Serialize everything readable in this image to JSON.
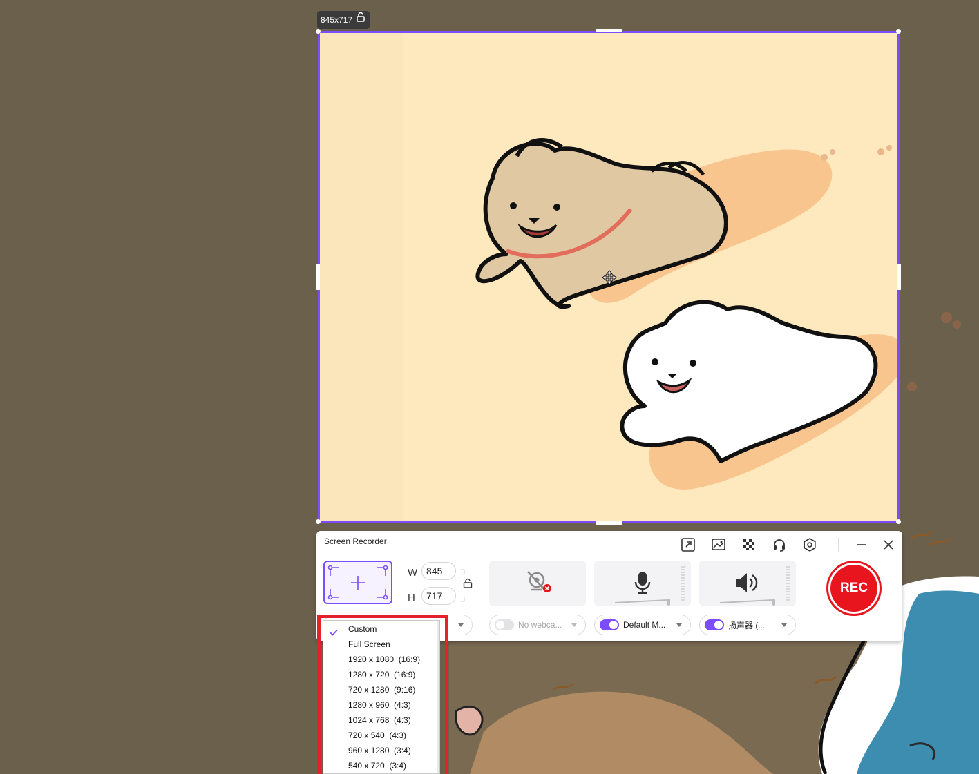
{
  "capture": {
    "size_label": "845x717"
  },
  "recorder": {
    "title": "Screen Recorder",
    "toolbar": {
      "icons": [
        "external-window-icon",
        "screenshot-edit-icon",
        "checkerboard-icon",
        "headset-icon",
        "settings-icon"
      ],
      "minimize_icon": "minimize-icon",
      "close_icon": "close-icon"
    },
    "width_label": "W",
    "height_label": "H",
    "width_value": "845",
    "height_value": "717",
    "webcam": {
      "label": "No webca...",
      "enabled": false
    },
    "microphone": {
      "label": "Default M...",
      "enabled": true
    },
    "speaker": {
      "label": "扬声器 (...",
      "enabled": true
    },
    "rec_label": "REC",
    "accent_color": "#7c4dff",
    "rec_color": "#e8141e"
  },
  "preset_menu": {
    "items": [
      {
        "label": "Custom",
        "checked": true
      },
      {
        "label": "Full Screen",
        "checked": false
      },
      {
        "label": "1920 x 1080  (16:9)",
        "checked": false
      },
      {
        "label": "1280 x 720  (16:9)",
        "checked": false
      },
      {
        "label": "720 x 1280  (9:16)",
        "checked": false
      },
      {
        "label": "1280 x 960  (4:3)",
        "checked": false
      },
      {
        "label": "1024 x 768  (4:3)",
        "checked": false
      },
      {
        "label": "720 x 540  (4:3)",
        "checked": false
      },
      {
        "label": "960 x 1280  (3:4)",
        "checked": false
      },
      {
        "label": "540 x 720  (3:4)",
        "checked": false
      }
    ],
    "highlight_color": "#e3222b"
  }
}
